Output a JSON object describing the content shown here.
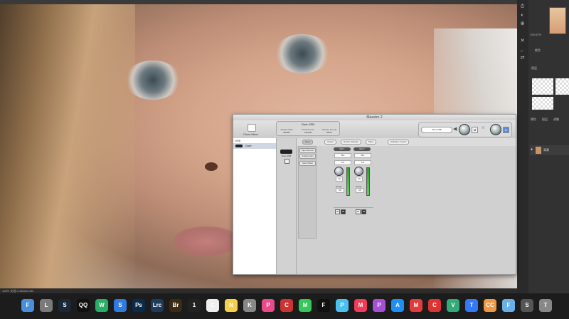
{
  "app": {
    "window_title": "Maestro 2",
    "device_name": "Duet USB",
    "control_mode_label": "Close Mixer",
    "lcd": {
      "col_labels": [
        "Sample Rate",
        "Clock Source",
        "Sample Format"
      ],
      "col_values": [
        "48 kHz",
        "Internal",
        "Mono"
      ]
    },
    "monitor": {
      "select_value": "Duet USB",
      "mute_label": "M",
      "dim_label": "D"
    }
  },
  "sidebar": {
    "header": "USB",
    "device_item": "Duet"
  },
  "tabs": [
    {
      "label": "Input",
      "active": true
    },
    {
      "label": "Output",
      "active": false
    },
    {
      "label": "Device Settings",
      "active": false
    },
    {
      "label": "Mixer",
      "active": false
    },
    {
      "label": "Software Control",
      "active": false
    }
  ],
  "row_labels": [
    "Input Source",
    "Analog Gain",
    "Gain Offset"
  ],
  "channels": [
    {
      "header": "Mic 1",
      "source": "Mic",
      "gain_value": "0.0",
      "knob_readout": "40",
      "trim_label": "Group",
      "trim_value": "Off"
    },
    {
      "header": "Mic 2",
      "source": "Mic",
      "gain_value": "0.0",
      "knob_readout": "40",
      "trim_label": "Group",
      "trim_value": "Off"
    }
  ],
  "left_col_header": "Duet USB",
  "toggle_labels": [
    "Ø",
    "48"
  ],
  "status_text": "100% 文档:2.43M/64.3M",
  "right_panel": {
    "zoom_text": "100.57%",
    "section_labels": [
      "属性",
      "图层",
      "调整"
    ],
    "layer_name": "背景",
    "label_a": "颜色",
    "label_b": "图层"
  },
  "dock": {
    "icons": [
      "Finder",
      "Launchpad",
      "Steam",
      "QQ",
      "WeChat",
      "Safari",
      "Ps",
      "Lrc",
      "Br",
      "1Password",
      "Clock",
      "Notes",
      "Keychain",
      "Photos",
      "Color",
      "Messages",
      "Final Cut",
      "Prime",
      "Music",
      "Podcasts",
      "App Store",
      "Music163",
      "Cleaner",
      "Vector",
      "Tailscale",
      "CC",
      "Folder",
      "Screen",
      "Trash"
    ],
    "colors": [
      "#4a8fd9",
      "#7a7a7a",
      "#1b2838",
      "#111",
      "#2aae67",
      "#2f7be0",
      "#0b2b4b",
      "#1e3b5b",
      "#3b2a14",
      "#222",
      "#eee",
      "#f5d04a",
      "#888",
      "#e94b8a",
      "#c33",
      "#35c759",
      "#111",
      "#4bc0f0",
      "#f23b56",
      "#a651d5",
      "#1e8ff5",
      "#e23b3b",
      "#d33",
      "#3a7",
      "#3478f6",
      "#e94",
      "#6ab0e6",
      "#555",
      "#888"
    ]
  }
}
